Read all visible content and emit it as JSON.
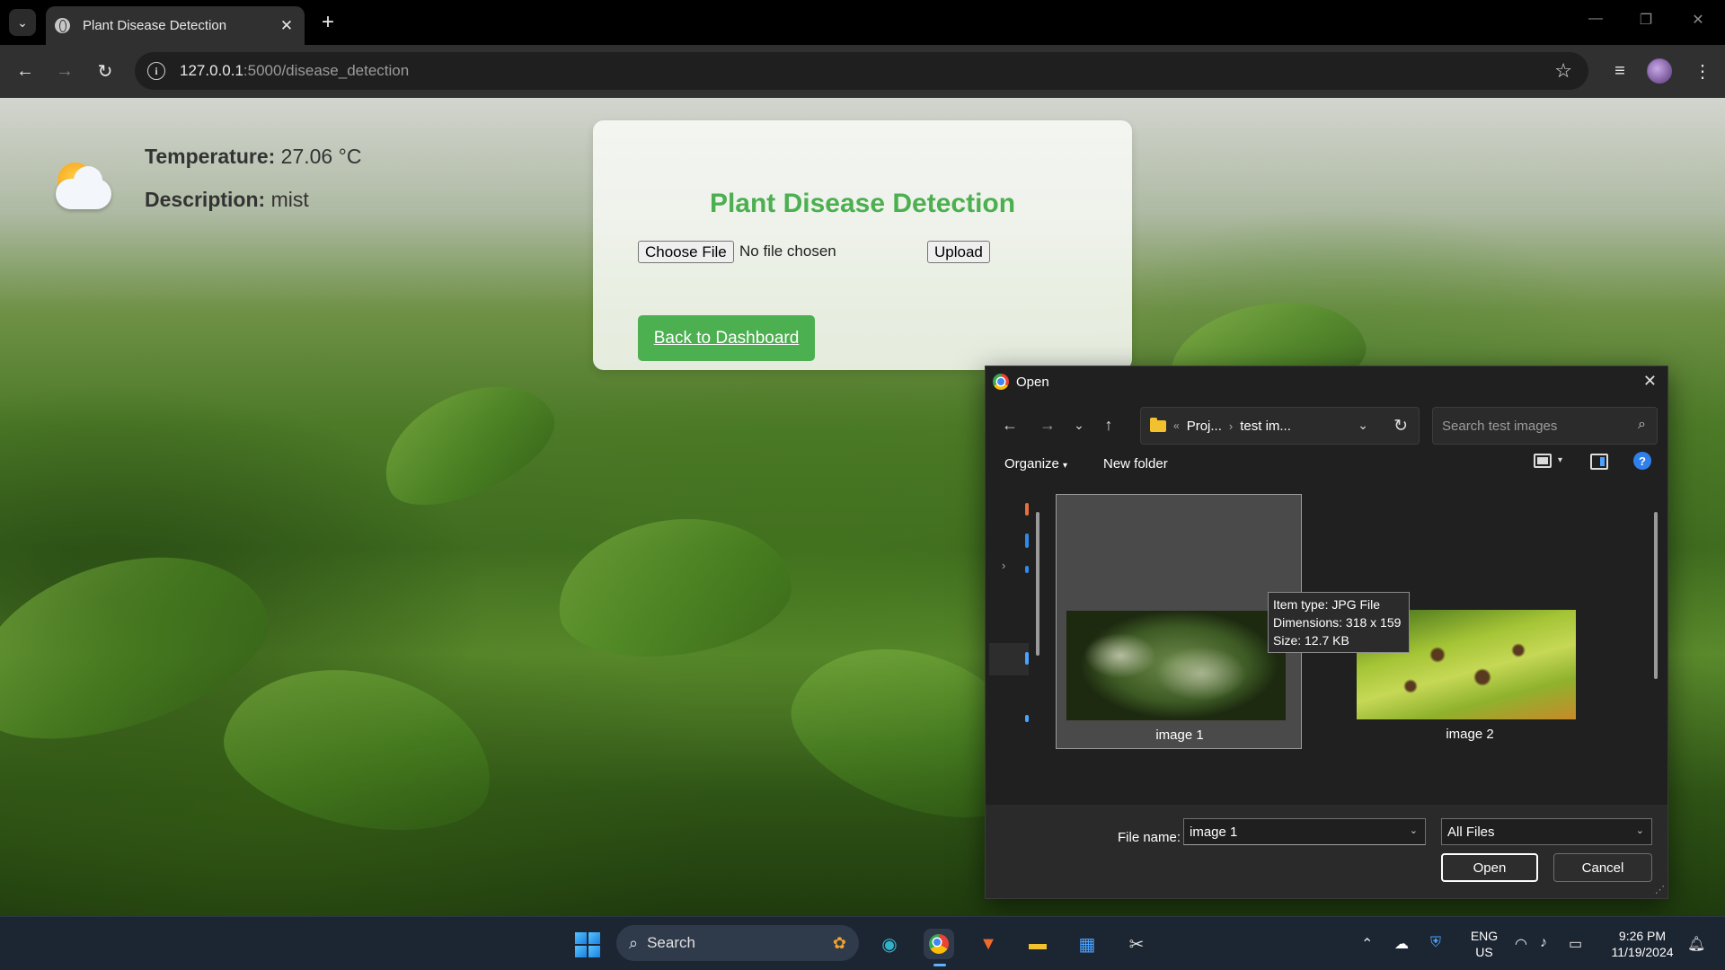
{
  "browser": {
    "tab_title": "Plant Disease Detection",
    "url_host": "127.0.0.1",
    "url_path": ":5000/disease_detection"
  },
  "weather": {
    "temperature_label": "Temperature:",
    "temperature_value": "27.06 °C",
    "description_label": "Description:",
    "description_value": "mist",
    "icon": "partly-cloudy-icon"
  },
  "card": {
    "title": "Plant Disease Detection",
    "choose_file_label": "Choose File",
    "no_file_text": "No file chosen",
    "upload_label": "Upload",
    "back_label": "Back to Dashboard",
    "accent_color": "#4caf50"
  },
  "dialog": {
    "title": "Open",
    "breadcrumb": [
      "Proj...",
      "test im..."
    ],
    "breadcrumb_prefix": "«",
    "search_placeholder": "Search test images",
    "organize_label": "Organize",
    "new_folder_label": "New folder",
    "help_label": "?",
    "files": [
      {
        "name": "image 1",
        "selected": true
      },
      {
        "name": "image 2",
        "selected": false
      }
    ],
    "tooltip": {
      "item_type": "Item type: JPG File",
      "dimensions": "Dimensions: 318 x 159",
      "size": "Size: 12.7 KB"
    },
    "file_name_label": "File name:",
    "file_name_value": "image 1",
    "file_type_value": "All Files",
    "open_label": "Open",
    "cancel_label": "Cancel"
  },
  "taskbar": {
    "search_label": "Search",
    "lang_top": "ENG",
    "lang_bottom": "US",
    "time": "9:26 PM",
    "date": "11/19/2024"
  }
}
